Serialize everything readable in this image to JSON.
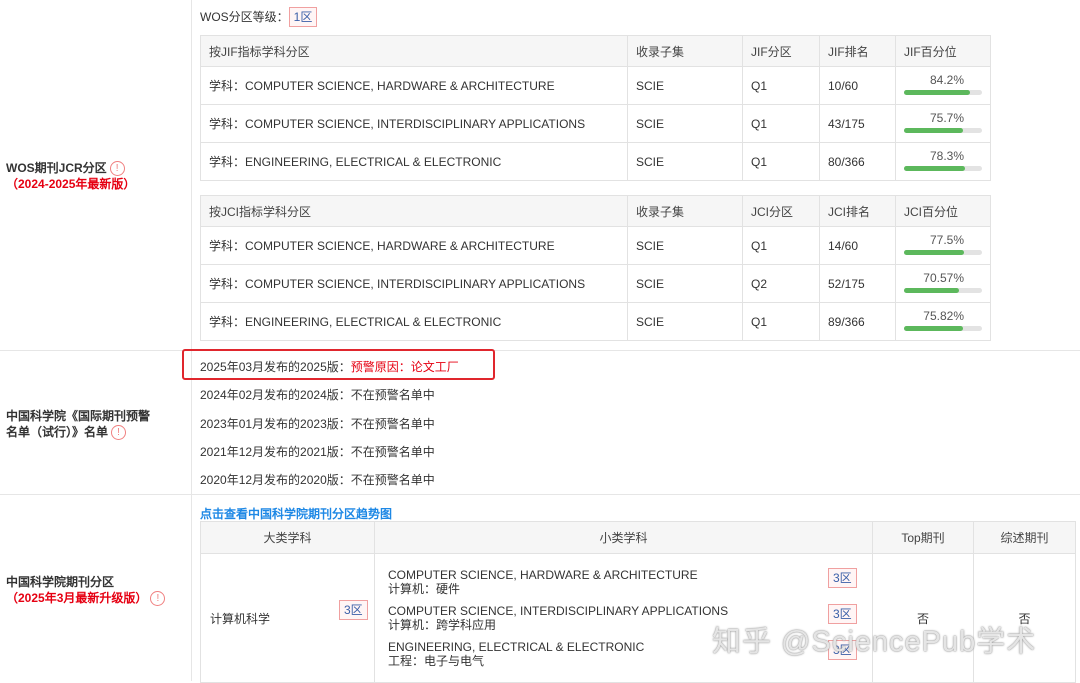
{
  "wos_jcr": {
    "label_line1": "WOS期刊JCR分区",
    "label_line2": "（2024-2025年最新版）",
    "wos_level_label": "WOS分区等级：",
    "wos_level_value": "1区",
    "jif_table": {
      "headers": [
        "按JIF指标学科分区",
        "收录子集",
        "JIF分区",
        "JIF排名",
        "JIF百分位"
      ],
      "rows": [
        {
          "subject": "学科：COMPUTER SCIENCE, HARDWARE & ARCHITECTURE",
          "subset": "SCIE",
          "quartile": "Q1",
          "rank": "10/60",
          "percentile": "84.2%",
          "fill": 84.2
        },
        {
          "subject": "学科：COMPUTER SCIENCE, INTERDISCIPLINARY APPLICATIONS",
          "subset": "SCIE",
          "quartile": "Q1",
          "rank": "43/175",
          "percentile": "75.7%",
          "fill": 75.7
        },
        {
          "subject": "学科：ENGINEERING, ELECTRICAL & ELECTRONIC",
          "subset": "SCIE",
          "quartile": "Q1",
          "rank": "80/366",
          "percentile": "78.3%",
          "fill": 78.3
        }
      ]
    },
    "jci_table": {
      "headers": [
        "按JCI指标学科分区",
        "收录子集",
        "JCI分区",
        "JCI排名",
        "JCI百分位"
      ],
      "rows": [
        {
          "subject": "学科：COMPUTER SCIENCE, HARDWARE & ARCHITECTURE",
          "subset": "SCIE",
          "quartile": "Q1",
          "rank": "14/60",
          "percentile": "77.5%",
          "fill": 77.5
        },
        {
          "subject": "学科：COMPUTER SCIENCE, INTERDISCIPLINARY APPLICATIONS",
          "subset": "SCIE",
          "quartile": "Q2",
          "rank": "52/175",
          "percentile": "70.57%",
          "fill": 70.57
        },
        {
          "subject": "学科：ENGINEERING, ELECTRICAL & ELECTRONIC",
          "subset": "SCIE",
          "quartile": "Q1",
          "rank": "89/366",
          "percentile": "75.82%",
          "fill": 75.82
        }
      ]
    }
  },
  "cas_warning": {
    "label_line1": "中国科学院《国际期刊预警",
    "label_line2": "名单（试行）》名单",
    "items": [
      {
        "prefix": "2025年03月发布的2025版：",
        "value": "预警原因：论文工厂",
        "highlight": true
      },
      {
        "prefix": "2024年02月发布的2024版：",
        "value": "不在预警名单中",
        "highlight": false
      },
      {
        "prefix": "2023年01月发布的2023版：",
        "value": "不在预警名单中",
        "highlight": false
      },
      {
        "prefix": "2021年12月发布的2021版：",
        "value": "不在预警名单中",
        "highlight": false
      },
      {
        "prefix": "2020年12月发布的2020版：",
        "value": "不在预警名单中",
        "highlight": false
      }
    ]
  },
  "cas_partition": {
    "label_line1": "中国科学院期刊分区",
    "label_line2": "（2025年3月最新升级版）",
    "trend_link": "点击查看中国科学院期刊分区趋势图",
    "headers": {
      "major": "大类学科",
      "minor": "小类学科",
      "top": "Top期刊",
      "review": "综述期刊"
    },
    "major": {
      "name": "计算机科学",
      "zone": "3区"
    },
    "minors": [
      {
        "en": "COMPUTER SCIENCE, HARDWARE & ARCHITECTURE",
        "cn": "计算机：硬件",
        "zone": "3区"
      },
      {
        "en": "COMPUTER SCIENCE, INTERDISCIPLINARY APPLICATIONS",
        "cn": "计算机：跨学科应用",
        "zone": "3区"
      },
      {
        "en": "ENGINEERING, ELECTRICAL & ELECTRONIC",
        "cn": "工程：电子与电气",
        "zone": "3区"
      }
    ],
    "top": "否",
    "review": "否"
  },
  "watermark": "知乎 @SciencePub学术",
  "colors": {
    "accent_red": "#e60012",
    "link_blue": "#1e88e5",
    "bar_green": "#5cb85c",
    "badge_text": "#3a5fa8"
  }
}
